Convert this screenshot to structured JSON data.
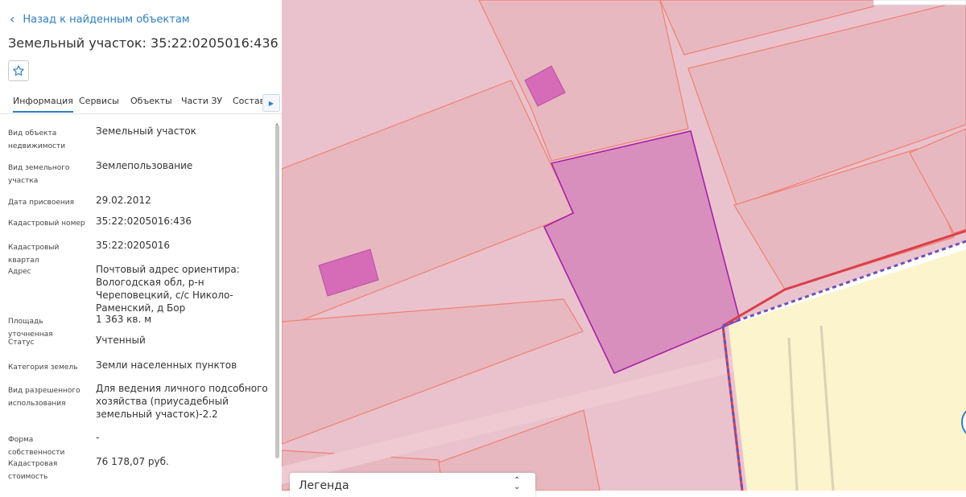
{
  "nav": {
    "back_label": "Назад к найденным объектам"
  },
  "object": {
    "title": "Земельный участок: 35:22:0205016:436"
  },
  "tabs": [
    {
      "label": "Информация",
      "active": true
    },
    {
      "label": "Сервисы",
      "active": false
    },
    {
      "label": "Объекты",
      "active": false
    },
    {
      "label": "Части ЗУ",
      "active": false
    },
    {
      "label": "Состав",
      "active": false
    }
  ],
  "info": {
    "type": {
      "label": "Вид объекта недвижимости",
      "value": "Земельный участок"
    },
    "kind": {
      "label": "Вид земельного участка",
      "value": "Землепользование"
    },
    "date": {
      "label": "Дата присвоения",
      "value": "29.02.2012"
    },
    "cad_number": {
      "label": "Кадастровый номер",
      "value": "35:22:0205016:436"
    },
    "cad_quarter": {
      "label": "Кадастровый квартал",
      "value": "35:22:0205016"
    },
    "address": {
      "label": "Адрес",
      "value": "Почтовый адрес ориентира: Вологодская обл, р-н Череповецкий, с/с Николо-Раменский, д Бор"
    },
    "area": {
      "label": "Площадь уточненная",
      "value": "1 363 кв. м"
    },
    "status": {
      "label": "Статус",
      "value": "Учтенный"
    },
    "category": {
      "label": "Категория земель",
      "value": "Земли населенных пунктов"
    },
    "permitted_use": {
      "label": "Вид разрешенного использования",
      "value": "Для ведения личного подсобного хозяйства (приусадебный земельный участок)-2.2"
    },
    "ownership": {
      "label": "Форма собственности",
      "value": "-"
    },
    "cad_cost": {
      "label": "Кадастровая стоимость",
      "value": "76 178,07 руб."
    }
  },
  "legend": {
    "label": "Легенда"
  },
  "icons": {
    "back": "chevron-left-icon",
    "favorite": "star-icon",
    "tabs_next": "chevron-right-icon",
    "legend_toggle": "chevron-up-down-icon"
  },
  "colors": {
    "accent": "#2f7fc1",
    "selected_parcel": "#d98fbd",
    "parcel_outline": "#f08070",
    "boundary_red": "#d9404a",
    "boundary_dashed": "#6a52b8",
    "settlement_zone": "#fbf4cc"
  }
}
